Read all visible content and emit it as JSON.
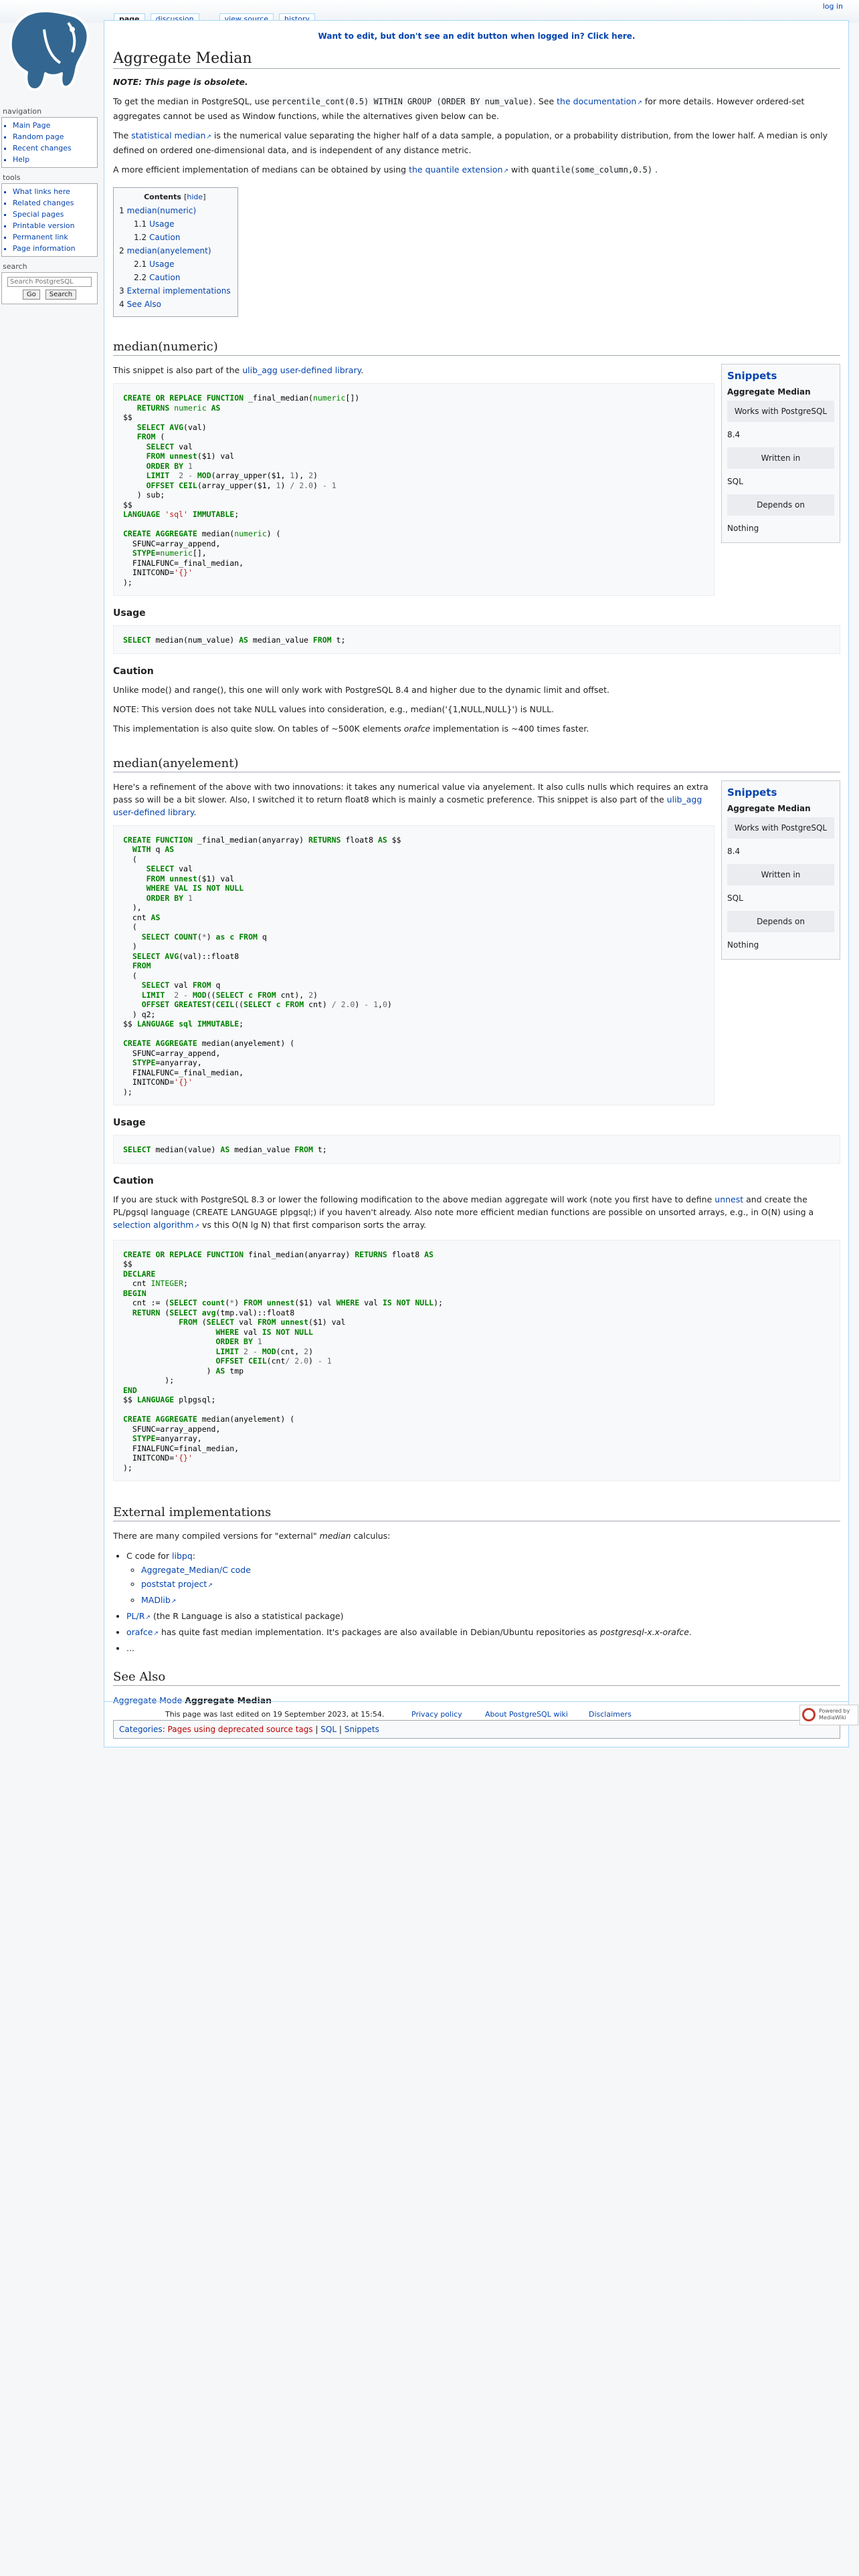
{
  "header": {
    "login": "log in",
    "tabs": [
      "page",
      "discussion",
      "view source",
      "history"
    ]
  },
  "sidebar": {
    "navigation": {
      "title": "navigation",
      "items": [
        "Main Page",
        "Random page",
        "Recent changes",
        "Help"
      ]
    },
    "tools": {
      "title": "tools",
      "items": [
        "What links here",
        "Related changes",
        "Special pages",
        "Printable version",
        "Permanent link",
        "Page information"
      ]
    },
    "search": {
      "title": "search",
      "placeholder": "Search PostgreSQL",
      "go": "Go",
      "search": "Search"
    }
  },
  "notice": "Want to edit, but don't see an edit button when logged in?  Click here.",
  "page": {
    "title": "Aggregate Median",
    "obsolete": "NOTE: This page is obsolete.",
    "intro1": {
      "a": "To get the median in PostgreSQL, use",
      "code": "percentile_cont(0.5) WITHIN GROUP (ORDER BY num_value)",
      "b": ". See",
      "link": "the documentation",
      "c": "for more details. However ordered-set aggregates cannot be used as Window functions, while the alternatives given below can be."
    },
    "intro2": {
      "a": "The",
      "link": "statistical median",
      "b": "is the numerical value separating the higher half of a data sample, a population, or a probability distribution, from the lower half. A median is only defined on ordered one-dimensional data, and is independent of any distance metric."
    },
    "intro3": {
      "a": "A more efficient implementation of medians can be obtained by using",
      "link": "the quantile extension",
      "b": "with",
      "code": "quantile(some_column,0.5)",
      "c": "."
    },
    "toc": {
      "title": "Contents",
      "hide": "hide",
      "items": [
        {
          "num": "1",
          "label": "median(numeric)"
        },
        {
          "num": "1.1",
          "label": "Usage"
        },
        {
          "num": "1.2",
          "label": "Caution"
        },
        {
          "num": "2",
          "label": "median(anyelement)"
        },
        {
          "num": "2.1",
          "label": "Usage"
        },
        {
          "num": "2.2",
          "label": "Caution"
        },
        {
          "num": "3",
          "label": "External implementations"
        },
        {
          "num": "4",
          "label": "See Also"
        }
      ]
    },
    "infobox": {
      "title": "Snippets",
      "name": "Aggregate Median",
      "works_label": "Works with PostgreSQL",
      "written_label": "Written in",
      "depends_label": "Depends on"
    },
    "sec1": {
      "heading": "median(numeric)",
      "infobox_works": "8.4",
      "infobox_written": "SQL",
      "infobox_depends": "Nothing",
      "intro_a": "This snippet is also part of the",
      "intro_link": "ulib_agg user-defined library",
      "intro_b": ".",
      "usage_heading": "Usage",
      "caution_heading": "Caution",
      "caution1": "Unlike mode() and range(), this one will only work with PostgreSQL 8.4 and higher due to the dynamic limit and offset.",
      "caution2": "NOTE: This version does not take NULL values into consideration, e.g., median('{1,NULL,NULL}') is NULL.",
      "caution3_a": "This implementation is also quite slow. On tables of ~500K elements",
      "caution3_em": "orafce",
      "caution3_b": "implementation is ~400 times faster."
    },
    "sec2": {
      "heading": "median(anyelement)",
      "infobox_works": "8.4",
      "infobox_written": "SQL",
      "infobox_depends": "Nothing",
      "intro_a": "Here's a refinement of the above with two innovations: it takes any numerical value via anyelement. It also culls nulls which requires an extra pass so will be a bit slower. Also, I switched it to return float8 which is mainly a cosmetic preference. This snippet is also part of the",
      "intro_link": "ulib_agg user-defined library",
      "intro_b": ".",
      "usage_heading": "Usage",
      "caution_heading": "Caution",
      "caution_a": "If you are stuck with PostgreSQL 8.3 or lower the following modification to the above median aggregate will work (note you first have to define",
      "caution_link1": "unnest",
      "caution_b": "and create the PL/pgsql language (CREATE LANGUAGE plpgsql;) if you haven't already. Also note more efficient median functions are possible on unsorted arrays, e.g., in O(N) using a",
      "caution_link2": "selection algorithm",
      "caution_c": "vs this O(N lg N) that first comparison sorts the array."
    },
    "sec3": {
      "heading": "External implementations",
      "intro_a": "There are many compiled versions for \"external\"",
      "intro_em": "median",
      "intro_b": "calculus:",
      "c_code_a": "C code for",
      "c_code_link": "libpq",
      "c_code_b": ":",
      "sub_links": [
        "Aggregate_Median/C code",
        "poststat project",
        "MADlib"
      ],
      "plr_link": "PL/R",
      "plr_text": "(the R Language is also a statistical package)",
      "orafce_link": "orafce",
      "orafce_a": "has quite fast median implementation. It's packages are also available in Debian/Ubuntu repositories as",
      "orafce_em": "postgresql-x.x-orafce",
      "orafce_b": ".",
      "ellipsis": "..."
    },
    "sec4": {
      "heading": "See Also",
      "link": "Aggregate Mode",
      "current": "Aggregate Median"
    },
    "categories": {
      "label": "Categories",
      "items": [
        "Pages using deprecated source tags",
        "SQL",
        "Snippets"
      ]
    }
  },
  "footer": {
    "lastmod": "This page was last edited on 19 September 2023, at 15:54.",
    "links": [
      "Privacy policy",
      "About PostgreSQL wiki",
      "Disclaimers"
    ],
    "powered": "Powered by MediaWiki"
  }
}
